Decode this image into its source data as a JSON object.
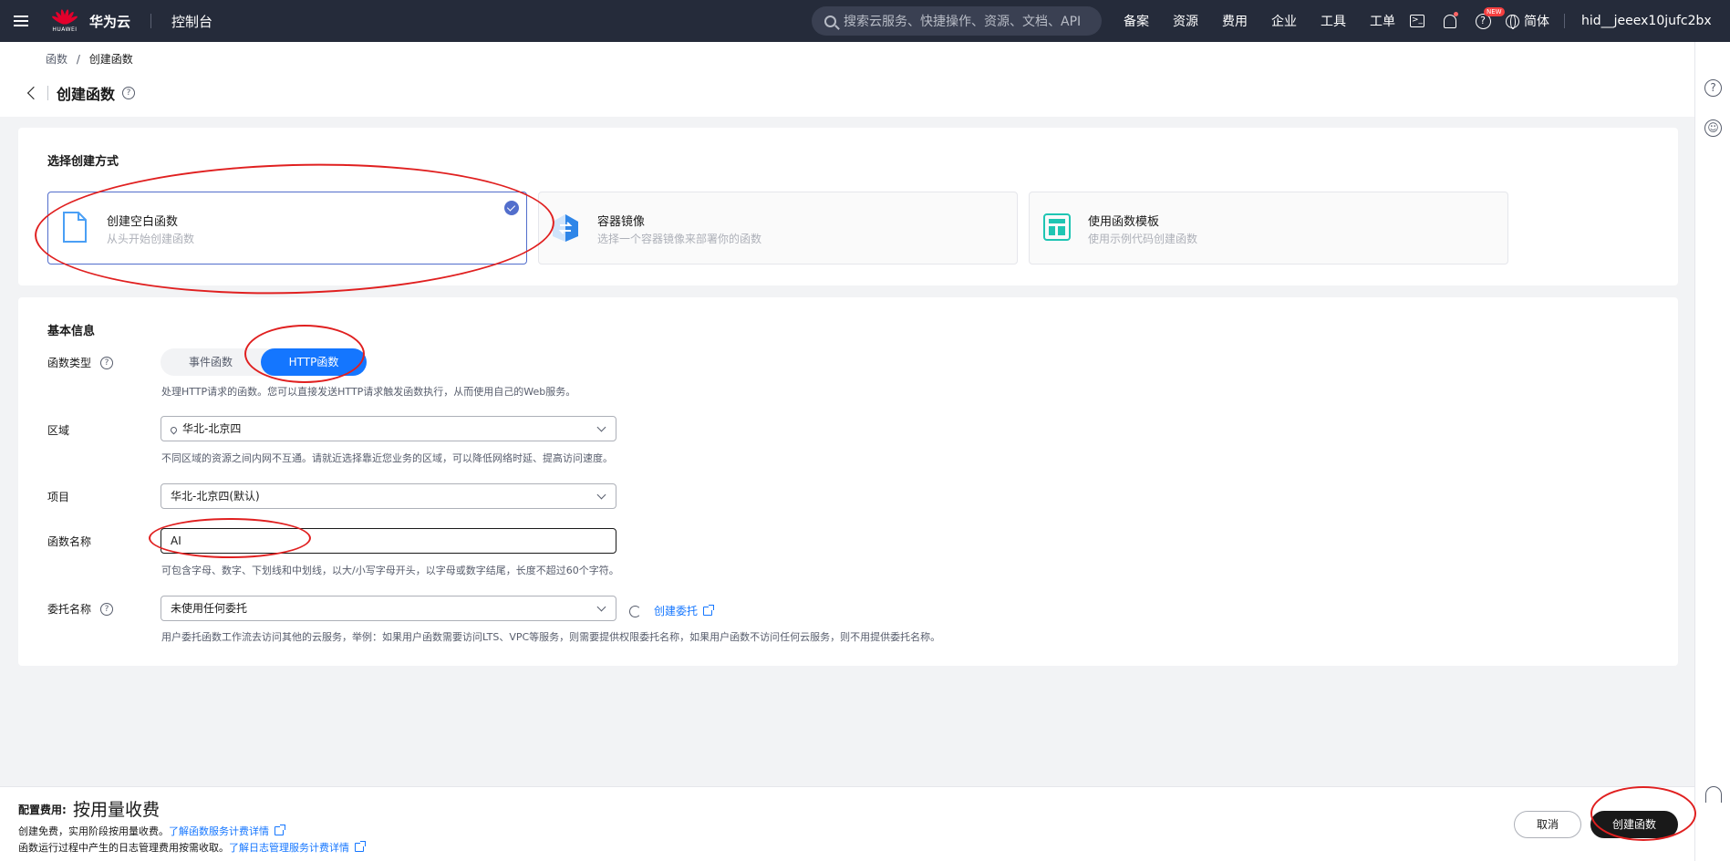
{
  "topbar": {
    "brand": "华为云",
    "logo_sub": "HUAWEI",
    "console": "控制台",
    "search_placeholder": "搜索云服务、快捷操作、资源、文档、API",
    "nav": [
      "备案",
      "资源",
      "费用",
      "企业",
      "工具",
      "工单"
    ],
    "new_badge": "NEW",
    "language": "简体",
    "user": "hid__jeeex10jufc2bx"
  },
  "breadcrumb": {
    "parent": "函数",
    "separator": "/",
    "current": "创建函数"
  },
  "page": {
    "title": "创建函数"
  },
  "method_section": {
    "title": "选择创建方式",
    "options": [
      {
        "title": "创建空白函数",
        "desc": "从头开始创建函数",
        "selected": true
      },
      {
        "title": "容器镜像",
        "desc": "选择一个容器镜像来部署你的函数",
        "selected": false
      },
      {
        "title": "使用函数模板",
        "desc": "使用示例代码创建函数",
        "selected": false
      }
    ]
  },
  "basic_info": {
    "title": "基本信息",
    "func_type": {
      "label": "函数类型",
      "options": [
        "事件函数",
        "HTTP函数"
      ],
      "selected": "HTTP函数",
      "hint": "处理HTTP请求的函数。您可以直接发送HTTP请求触发函数执行，从而使用自己的Web服务。"
    },
    "region": {
      "label": "区域",
      "value": "华北-北京四",
      "hint": "不同区域的资源之间内网不互通。请就近选择靠近您业务的区域，可以降低网络时延、提高访问速度。"
    },
    "project": {
      "label": "项目",
      "value": "华北-北京四(默认)"
    },
    "func_name": {
      "label": "函数名称",
      "value": "AI",
      "hint": "可包含字母、数字、下划线和中划线，以大/小写字母开头，以字母或数字结尾，长度不超过60个字符。"
    },
    "agency": {
      "label": "委托名称",
      "value": "未使用任何委托",
      "create_link": "创建委托",
      "hint": "用户委托函数工作流去访问其他的云服务，举例：如果用户函数需要访问LTS、VPC等服务，则需要提供权限委托名称，如果用户函数不访问任何云服务，则不用提供委托名称。"
    }
  },
  "footer": {
    "fee_label": "配置费用:",
    "fee_value": "按用量收费",
    "line1_text": "创建免费，实用阶段按用量收费。",
    "line1_link": "了解函数服务计费详情",
    "line2_text": "函数运行过程中产生的日志管理费用按需收取。",
    "line2_link": "了解日志管理服务计费详情",
    "cancel": "取消",
    "create": "创建函数"
  },
  "colors": {
    "accent": "#1476ff",
    "selected_border": "#526ecc",
    "annotation": "#e02020",
    "topbar": "#252b3a"
  }
}
